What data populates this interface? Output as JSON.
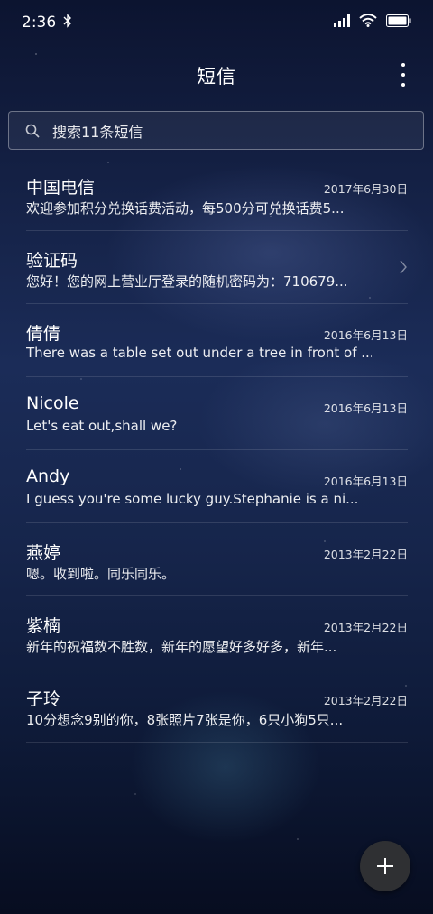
{
  "status_bar": {
    "time": "2:36"
  },
  "header": {
    "title": "短信"
  },
  "search": {
    "placeholder": "搜索11条短信"
  },
  "conversations": [
    {
      "name": "中国电信",
      "date": "2017年6月30日",
      "preview": "欢迎参加积分兑换话费活动，每500分可兑换话费5..."
    },
    {
      "name": "验证码",
      "date": "",
      "preview": "您好！您的网上营业厅登录的随机密码为：710679..."
    },
    {
      "name": "倩倩",
      "date": "2016年6月13日",
      "preview": "There was a table set out under a tree in front of ..."
    },
    {
      "name": "Nicole",
      "date": "2016年6月13日",
      "preview": "Let's eat out,shall we?"
    },
    {
      "name": "Andy",
      "date": "2016年6月13日",
      "preview": "I guess you're some lucky guy.Stephanie is a ni..."
    },
    {
      "name": "燕婷",
      "date": "2013年2月22日",
      "preview": "嗯。收到啦。同乐同乐。"
    },
    {
      "name": "紫楠",
      "date": "2013年2月22日",
      "preview": "新年的祝福数不胜数，新年的愿望好多好多，新年..."
    },
    {
      "name": "子玲",
      "date": "2013年2月22日",
      "preview": "10分想念9别的你，8张照片7张是你，6只小狗5只..."
    }
  ],
  "icons": {
    "bluetooth": "bluetooth-icon",
    "signal": "signal-icon",
    "wifi": "wifi-icon",
    "battery": "battery-icon",
    "more": "more-vertical-icon",
    "search": "search-icon",
    "chevron": "chevron-right-icon",
    "compose": "plus-icon"
  }
}
